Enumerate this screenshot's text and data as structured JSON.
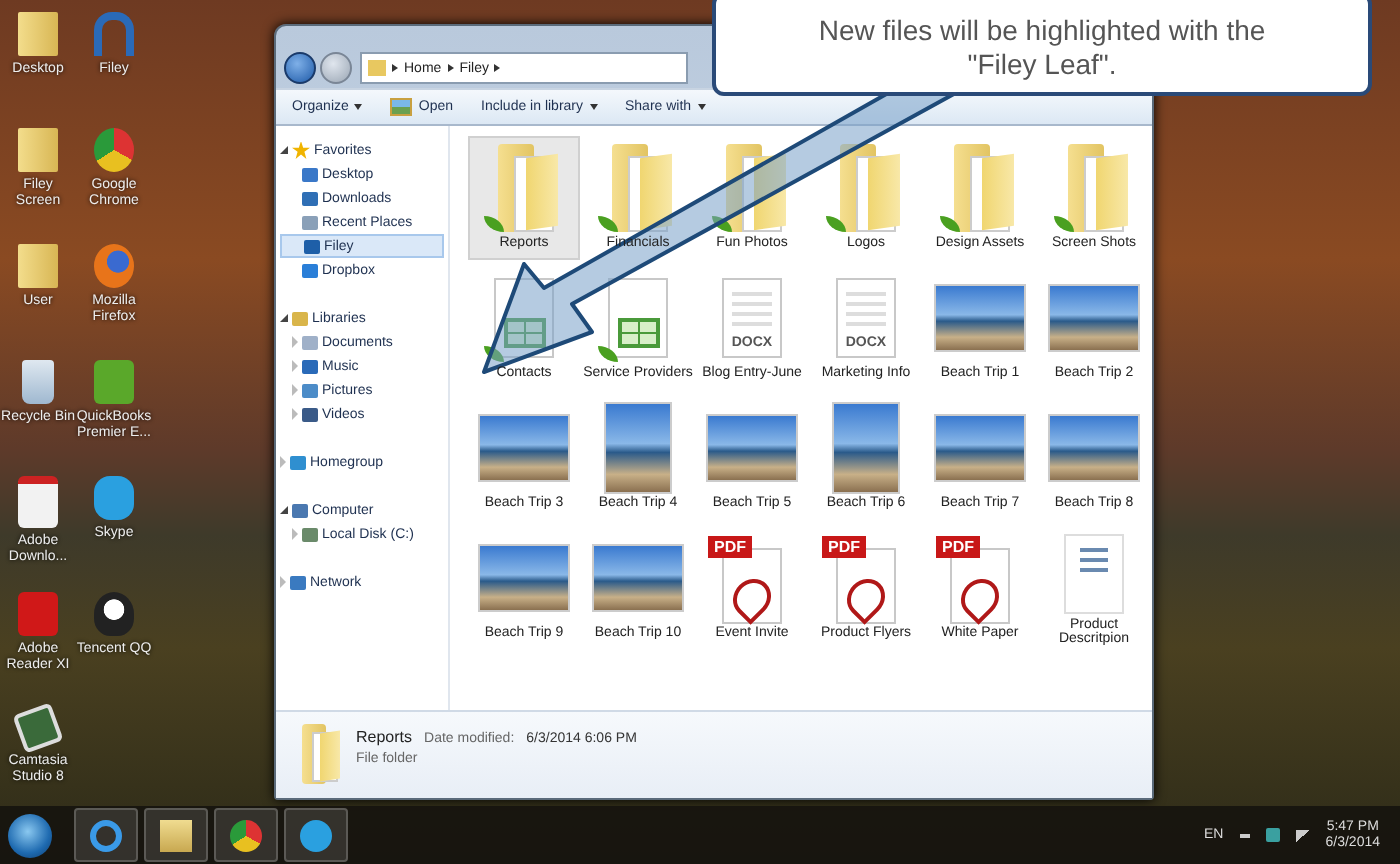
{
  "desktop_icons": [
    {
      "label": "Desktop",
      "kind": "folder"
    },
    {
      "label": "Filey",
      "kind": "filey"
    },
    {
      "label": "Filey Screen",
      "kind": "folder"
    },
    {
      "label": "Google Chrome",
      "kind": "chrome"
    },
    {
      "label": "User",
      "kind": "folder"
    },
    {
      "label": "Mozilla Firefox",
      "kind": "firefox"
    },
    {
      "label": "Recycle Bin",
      "kind": "recycle"
    },
    {
      "label": "QuickBooks Premier E...",
      "kind": "quickbooks"
    },
    {
      "label": "Adobe Downlo...",
      "kind": "adobe"
    },
    {
      "label": "Skype",
      "kind": "skype"
    },
    {
      "label": "Adobe Reader XI",
      "kind": "acrobat"
    },
    {
      "label": "Tencent QQ",
      "kind": "qq"
    },
    {
      "label": "Camtasia Studio 8",
      "kind": "camtasia"
    }
  ],
  "explorer": {
    "breadcrumb": [
      "Home",
      "Filey"
    ],
    "toolbar": [
      {
        "label": "Organize",
        "dropdown": true,
        "kind": "plain"
      },
      {
        "label": "Open",
        "dropdown": false,
        "kind": "open"
      },
      {
        "label": "Include in library",
        "dropdown": true,
        "kind": "plain"
      },
      {
        "label": "Share with",
        "dropdown": true,
        "kind": "plain"
      }
    ],
    "nav": [
      {
        "label": "Favorites",
        "kind": "star",
        "expanded": true,
        "selected": false,
        "children": [
          {
            "label": "Desktop",
            "kind": "desktop",
            "selected": false
          },
          {
            "label": "Downloads",
            "kind": "downloads",
            "selected": false
          },
          {
            "label": "Recent Places",
            "kind": "places",
            "selected": false
          },
          {
            "label": "Filey",
            "kind": "filey",
            "selected": true
          },
          {
            "label": "Dropbox",
            "kind": "dropbox",
            "selected": false
          }
        ]
      },
      {
        "label": "Libraries",
        "kind": "library",
        "expanded": true,
        "selected": false,
        "children": [
          {
            "label": "Documents",
            "kind": "doc",
            "expanded": false,
            "selected": false
          },
          {
            "label": "Music",
            "kind": "music",
            "expanded": false,
            "selected": false
          },
          {
            "label": "Pictures",
            "kind": "pictures",
            "expanded": false,
            "selected": false
          },
          {
            "label": "Videos",
            "kind": "videos",
            "expanded": false,
            "selected": false
          }
        ]
      },
      {
        "label": "Homegroup",
        "kind": "homegroup",
        "expanded": false,
        "selected": false
      },
      {
        "label": "Computer",
        "kind": "computer",
        "expanded": true,
        "selected": false,
        "children": [
          {
            "label": "Local Disk (C:)",
            "kind": "disk",
            "expanded": false,
            "selected": false
          }
        ]
      },
      {
        "label": "Network",
        "kind": "network",
        "expanded": false,
        "selected": false
      }
    ],
    "files": [
      {
        "name": "Reports",
        "kind": "folder",
        "new": true,
        "selected": true
      },
      {
        "name": "Financials",
        "kind": "folder",
        "new": true,
        "selected": false
      },
      {
        "name": "Fun Photos",
        "kind": "folder",
        "new": true,
        "selected": false
      },
      {
        "name": "Logos",
        "kind": "folder",
        "new": true,
        "selected": false
      },
      {
        "name": "Design Assets",
        "kind": "folder",
        "new": true,
        "selected": false
      },
      {
        "name": "Screen Shots",
        "kind": "folder",
        "new": true,
        "selected": false
      },
      {
        "name": "Contacts",
        "kind": "sheet",
        "new": true,
        "selected": false
      },
      {
        "name": "Service Providers",
        "kind": "sheet",
        "new": true,
        "selected": false
      },
      {
        "name": "Blog Entry-June",
        "kind": "docx",
        "badge": "DOCX",
        "new": false,
        "selected": false
      },
      {
        "name": "Marketing Info",
        "kind": "docx",
        "badge": "DOCX",
        "new": false,
        "selected": false
      },
      {
        "name": "Beach Trip 1",
        "kind": "photo",
        "new": false,
        "selected": false
      },
      {
        "name": "Beach Trip 2",
        "kind": "photo",
        "new": false,
        "selected": false
      },
      {
        "name": "Beach Trip 3",
        "kind": "photo",
        "new": false,
        "selected": false
      },
      {
        "name": "Beach Trip 4",
        "kind": "photo_tall",
        "new": false,
        "selected": false
      },
      {
        "name": "Beach Trip 5",
        "kind": "photo",
        "new": false,
        "selected": false
      },
      {
        "name": "Beach Trip 6",
        "kind": "photo_tall",
        "new": false,
        "selected": false
      },
      {
        "name": "Beach Trip 7",
        "kind": "photo",
        "new": false,
        "selected": false
      },
      {
        "name": "Beach Trip 8",
        "kind": "photo",
        "new": false,
        "selected": false
      },
      {
        "name": "Beach Trip 9",
        "kind": "photo",
        "new": false,
        "selected": false
      },
      {
        "name": "Beach Trip 10",
        "kind": "photo",
        "new": false,
        "selected": false
      },
      {
        "name": "Event Invite",
        "kind": "pdf",
        "badge": "PDF",
        "new": false,
        "selected": false
      },
      {
        "name": "Product Flyers",
        "kind": "pdf",
        "badge": "PDF",
        "new": false,
        "selected": false
      },
      {
        "name": "White Paper",
        "kind": "pdf",
        "badge": "PDF",
        "new": false,
        "selected": false
      },
      {
        "name": "Product Descritpion",
        "kind": "doc",
        "new": false,
        "selected": false
      }
    ],
    "status": {
      "name": "Reports",
      "date_label": "Date modified:",
      "date": "6/3/2014 6:06 PM",
      "type": "File folder"
    }
  },
  "callout": {
    "text": "New files will be highlighted with the \"Filey Leaf\"."
  },
  "taskbar": {
    "buttons": [
      {
        "kind": "ie"
      },
      {
        "kind": "explorer"
      },
      {
        "kind": "chrome"
      },
      {
        "kind": "skype"
      }
    ],
    "language": "EN",
    "time": "5:47 PM",
    "date": "6/3/2014"
  }
}
